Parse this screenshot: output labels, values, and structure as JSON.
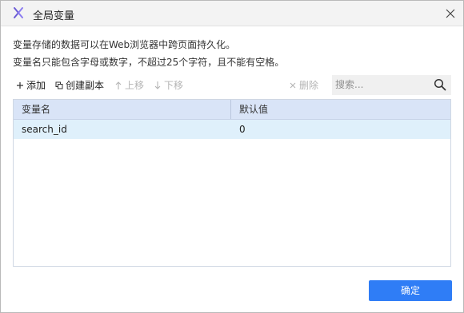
{
  "window": {
    "title": "全局变量",
    "app_icon": "x-logo-icon",
    "close_icon": "close-icon"
  },
  "description": {
    "line1": "变量存储的数据可以在Web浏览器中跨页面持久化。",
    "line2": "变量名只能包含字母或数字，不超过25个字符，且不能有空格。"
  },
  "toolbar": {
    "add_label": "添加",
    "copy_label": "创建副本",
    "move_up_label": "上移",
    "move_down_label": "下移",
    "delete_label": "删除",
    "search_placeholder": "搜索..."
  },
  "table": {
    "columns": [
      "变量名",
      "默认值"
    ],
    "rows": [
      {
        "name": "search_id",
        "value": "0"
      }
    ]
  },
  "footer": {
    "ok_label": "确定"
  },
  "colors": {
    "primary": "#2f7df6",
    "header_bg": "#d9e4f7",
    "selected_row_bg": "#dff0fb",
    "disabled_text": "#b4b4b4",
    "app_icon_color": "#6b5bd6"
  }
}
